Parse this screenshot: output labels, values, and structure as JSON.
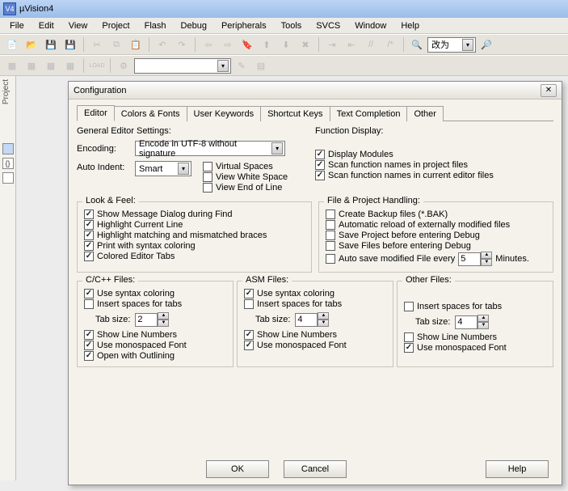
{
  "window_title": "µVision4",
  "menus": [
    "File",
    "Edit",
    "View",
    "Project",
    "Flash",
    "Debug",
    "Peripherals",
    "Tools",
    "SVCS",
    "Window",
    "Help"
  ],
  "toolbar2_input": "改为",
  "left_tab": "Project",
  "dialog": {
    "title": "Configuration",
    "tabs": [
      "Editor",
      "Colors & Fonts",
      "User Keywords",
      "Shortcut Keys",
      "Text Completion",
      "Other"
    ],
    "general": {
      "heading": "General Editor Settings:",
      "encoding_label": "Encoding:",
      "encoding_value": "Encode in UTF-8 without signature",
      "autoindent_label": "Auto Indent:",
      "autoindent_value": "Smart",
      "virtual_spaces": "Virtual Spaces",
      "view_white": "View White Space",
      "view_eol": "View End of Line"
    },
    "funcdisp": {
      "heading": "Function Display:",
      "display_modules": "Display Modules",
      "scan_project": "Scan function names in project files",
      "scan_editor": "Scan function names in current editor files"
    },
    "look": {
      "heading": "Look & Feel:",
      "msg_dialog": "Show Message Dialog during Find",
      "hilite_line": "Highlight Current Line",
      "hilite_braces": "Highlight matching and mismatched braces",
      "print_color": "Print with syntax coloring",
      "colored_tabs": "Colored Editor Tabs"
    },
    "fph": {
      "heading": "File & Project Handling:",
      "backup": "Create Backup files (*.BAK)",
      "autoreload": "Automatic reload of externally modified files",
      "save_proj": "Save Project before entering Debug",
      "save_files": "Save Files before entering Debug",
      "autosave": "Auto save modified File every",
      "autosave_val": "5",
      "autosave_suffix": "Minutes."
    },
    "ccpp": {
      "heading": "C/C++ Files:",
      "syntax": "Use syntax coloring",
      "insert_tabs": "Insert spaces for tabs",
      "tabsize_label": "Tab size:",
      "tabsize": "2",
      "linenums": "Show Line Numbers",
      "mono": "Use monospaced Font",
      "outlining": "Open with Outlining"
    },
    "asm": {
      "heading": "ASM Files:",
      "syntax": "Use syntax coloring",
      "insert_tabs": "Insert spaces for tabs",
      "tabsize_label": "Tab size:",
      "tabsize": "4",
      "linenums": "Show Line Numbers",
      "mono": "Use monospaced Font"
    },
    "other": {
      "heading": "Other Files:",
      "insert_tabs": "Insert spaces for tabs",
      "tabsize_label": "Tab size:",
      "tabsize": "4",
      "linenums": "Show Line Numbers",
      "mono": "Use monospaced Font"
    },
    "buttons": {
      "ok": "OK",
      "cancel": "Cancel",
      "help": "Help"
    }
  }
}
